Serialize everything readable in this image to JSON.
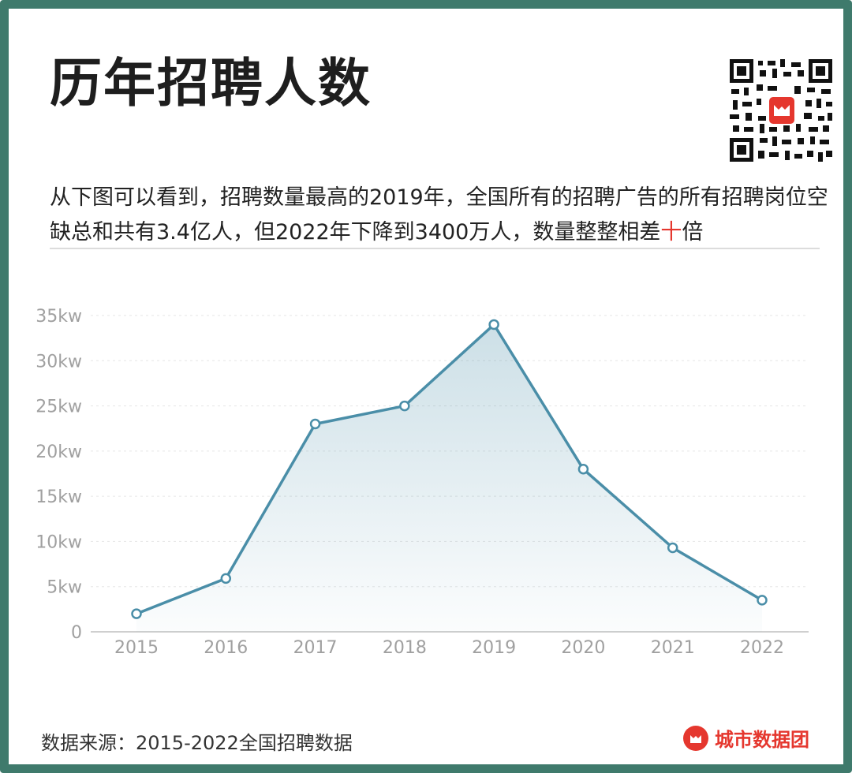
{
  "title": "历年招聘人数",
  "description": {
    "part1": "从下图可以看到，招聘数量最高的2019年，全国所有的招聘广告的所有招聘岗位空缺总和共有3.4亿人，但2022年下降到3400万人，数量整整相差",
    "highlight": "十",
    "part2": "倍"
  },
  "footer": {
    "source": "数据来源：2015-2022全国招聘数据",
    "brand": "城市数据团"
  },
  "colors": {
    "frame": "#3f7a6c",
    "line": "#4a8ea8",
    "highlight": "#e5372e"
  },
  "chart_data": {
    "type": "area",
    "categories": [
      "2015",
      "2016",
      "2017",
      "2018",
      "2019",
      "2020",
      "2021",
      "2022"
    ],
    "values": [
      2,
      5.9,
      23,
      25,
      34,
      18,
      9.3,
      3.5
    ],
    "ytick_labels": [
      "0",
      "5kw",
      "10kw",
      "15kw",
      "20kw",
      "25kw",
      "30kw",
      "35kw"
    ],
    "yticks": [
      0,
      5,
      10,
      15,
      20,
      25,
      30,
      35
    ],
    "ylim": [
      0,
      35
    ],
    "title": "",
    "xlabel": "",
    "ylabel": "",
    "grid": true
  }
}
